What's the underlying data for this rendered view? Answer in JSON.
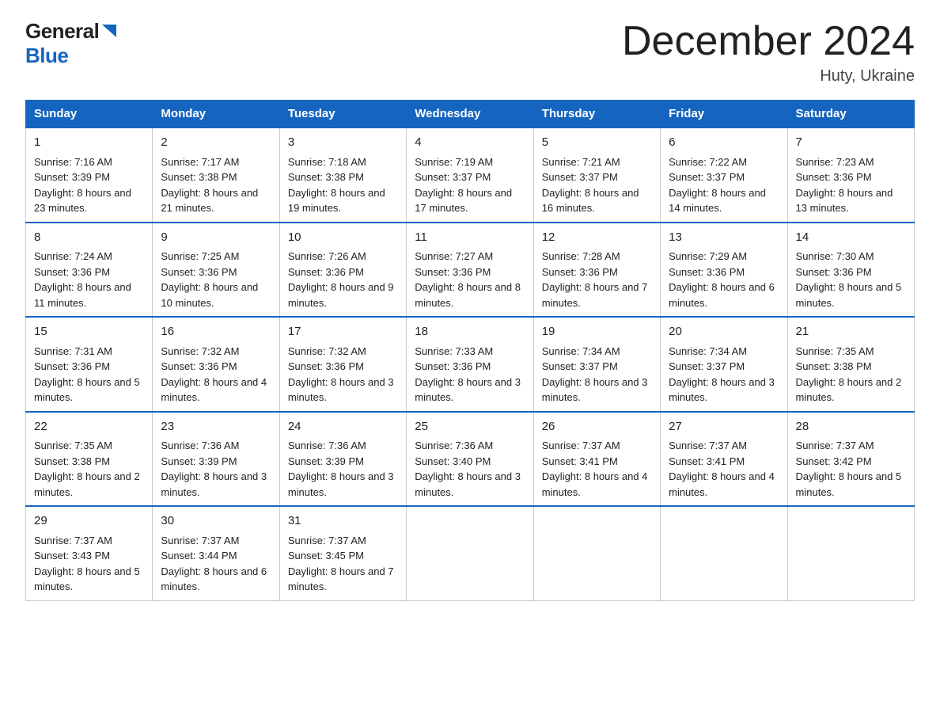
{
  "header": {
    "logo_general": "General",
    "logo_blue": "Blue",
    "month_title": "December 2024",
    "location": "Huty, Ukraine"
  },
  "days_of_week": [
    "Sunday",
    "Monday",
    "Tuesday",
    "Wednesday",
    "Thursday",
    "Friday",
    "Saturday"
  ],
  "weeks": [
    [
      {
        "day": "1",
        "sunrise": "7:16 AM",
        "sunset": "3:39 PM",
        "daylight": "8 hours and 23 minutes."
      },
      {
        "day": "2",
        "sunrise": "7:17 AM",
        "sunset": "3:38 PM",
        "daylight": "8 hours and 21 minutes."
      },
      {
        "day": "3",
        "sunrise": "7:18 AM",
        "sunset": "3:38 PM",
        "daylight": "8 hours and 19 minutes."
      },
      {
        "day": "4",
        "sunrise": "7:19 AM",
        "sunset": "3:37 PM",
        "daylight": "8 hours and 17 minutes."
      },
      {
        "day": "5",
        "sunrise": "7:21 AM",
        "sunset": "3:37 PM",
        "daylight": "8 hours and 16 minutes."
      },
      {
        "day": "6",
        "sunrise": "7:22 AM",
        "sunset": "3:37 PM",
        "daylight": "8 hours and 14 minutes."
      },
      {
        "day": "7",
        "sunrise": "7:23 AM",
        "sunset": "3:36 PM",
        "daylight": "8 hours and 13 minutes."
      }
    ],
    [
      {
        "day": "8",
        "sunrise": "7:24 AM",
        "sunset": "3:36 PM",
        "daylight": "8 hours and 11 minutes."
      },
      {
        "day": "9",
        "sunrise": "7:25 AM",
        "sunset": "3:36 PM",
        "daylight": "8 hours and 10 minutes."
      },
      {
        "day": "10",
        "sunrise": "7:26 AM",
        "sunset": "3:36 PM",
        "daylight": "8 hours and 9 minutes."
      },
      {
        "day": "11",
        "sunrise": "7:27 AM",
        "sunset": "3:36 PM",
        "daylight": "8 hours and 8 minutes."
      },
      {
        "day": "12",
        "sunrise": "7:28 AM",
        "sunset": "3:36 PM",
        "daylight": "8 hours and 7 minutes."
      },
      {
        "day": "13",
        "sunrise": "7:29 AM",
        "sunset": "3:36 PM",
        "daylight": "8 hours and 6 minutes."
      },
      {
        "day": "14",
        "sunrise": "7:30 AM",
        "sunset": "3:36 PM",
        "daylight": "8 hours and 5 minutes."
      }
    ],
    [
      {
        "day": "15",
        "sunrise": "7:31 AM",
        "sunset": "3:36 PM",
        "daylight": "8 hours and 5 minutes."
      },
      {
        "day": "16",
        "sunrise": "7:32 AM",
        "sunset": "3:36 PM",
        "daylight": "8 hours and 4 minutes."
      },
      {
        "day": "17",
        "sunrise": "7:32 AM",
        "sunset": "3:36 PM",
        "daylight": "8 hours and 3 minutes."
      },
      {
        "day": "18",
        "sunrise": "7:33 AM",
        "sunset": "3:36 PM",
        "daylight": "8 hours and 3 minutes."
      },
      {
        "day": "19",
        "sunrise": "7:34 AM",
        "sunset": "3:37 PM",
        "daylight": "8 hours and 3 minutes."
      },
      {
        "day": "20",
        "sunrise": "7:34 AM",
        "sunset": "3:37 PM",
        "daylight": "8 hours and 3 minutes."
      },
      {
        "day": "21",
        "sunrise": "7:35 AM",
        "sunset": "3:38 PM",
        "daylight": "8 hours and 2 minutes."
      }
    ],
    [
      {
        "day": "22",
        "sunrise": "7:35 AM",
        "sunset": "3:38 PM",
        "daylight": "8 hours and 2 minutes."
      },
      {
        "day": "23",
        "sunrise": "7:36 AM",
        "sunset": "3:39 PM",
        "daylight": "8 hours and 3 minutes."
      },
      {
        "day": "24",
        "sunrise": "7:36 AM",
        "sunset": "3:39 PM",
        "daylight": "8 hours and 3 minutes."
      },
      {
        "day": "25",
        "sunrise": "7:36 AM",
        "sunset": "3:40 PM",
        "daylight": "8 hours and 3 minutes."
      },
      {
        "day": "26",
        "sunrise": "7:37 AM",
        "sunset": "3:41 PM",
        "daylight": "8 hours and 4 minutes."
      },
      {
        "day": "27",
        "sunrise": "7:37 AM",
        "sunset": "3:41 PM",
        "daylight": "8 hours and 4 minutes."
      },
      {
        "day": "28",
        "sunrise": "7:37 AM",
        "sunset": "3:42 PM",
        "daylight": "8 hours and 5 minutes."
      }
    ],
    [
      {
        "day": "29",
        "sunrise": "7:37 AM",
        "sunset": "3:43 PM",
        "daylight": "8 hours and 5 minutes."
      },
      {
        "day": "30",
        "sunrise": "7:37 AM",
        "sunset": "3:44 PM",
        "daylight": "8 hours and 6 minutes."
      },
      {
        "day": "31",
        "sunrise": "7:37 AM",
        "sunset": "3:45 PM",
        "daylight": "8 hours and 7 minutes."
      },
      null,
      null,
      null,
      null
    ]
  ]
}
